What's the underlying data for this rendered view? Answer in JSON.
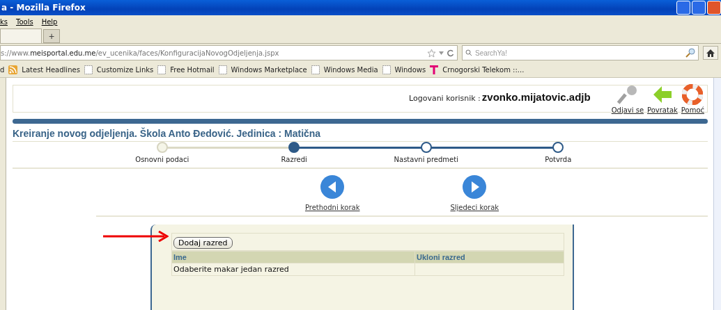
{
  "window": {
    "title": "a - Mozilla Firefox"
  },
  "menu": [
    "ks",
    "Tools",
    "Help"
  ],
  "tabs": {
    "new_tab": "+"
  },
  "address_bar": {
    "url": "s://www.**meisportal.edu.me**/ev_ucenika/faces/KonfiguracijaNovogOdjeljenja.jspx"
  },
  "search": {
    "placeholder": "SearchYa!"
  },
  "bookmarks": [
    {
      "kind": "text",
      "label": "d"
    },
    {
      "kind": "feed",
      "label": "Latest Headlines"
    },
    {
      "kind": "page",
      "label": "Customize Links"
    },
    {
      "kind": "page",
      "label": "Free Hotmail"
    },
    {
      "kind": "page",
      "label": "Windows Marketplace"
    },
    {
      "kind": "page",
      "label": "Windows Media"
    },
    {
      "kind": "page",
      "label": "Windows"
    },
    {
      "kind": "telekom",
      "label": "Crnogorski Telekom ::..."
    }
  ],
  "header": {
    "user_label": "Logovani korisnik :",
    "username": "zvonko.mijatovic.adjb",
    "links": [
      {
        "kind": "logout",
        "label": "Odjavi se"
      },
      {
        "kind": "back",
        "label": "Povratak"
      },
      {
        "kind": "help",
        "label": "Pomoć"
      }
    ]
  },
  "page_title": "Kreiranje novog odjeljenja. Škola Anto Đedović. Jedinica : Matična",
  "steps": [
    {
      "label": "Osnovni podaci",
      "visited": true,
      "selected": false
    },
    {
      "label": "Razredi",
      "visited": true,
      "selected": true
    },
    {
      "label": "Nastavni predmeti",
      "visited": false,
      "selected": false
    },
    {
      "label": "Potvrda",
      "visited": false,
      "selected": false
    }
  ],
  "navigation": [
    {
      "kind": "prev",
      "label": "Prethodni korak"
    },
    {
      "kind": "next",
      "label": "Sljedeci korak"
    }
  ],
  "panel": {
    "add_button": "Dodaj razred",
    "columns": [
      "Ime",
      "Ukloni razred"
    ],
    "rows": [
      {
        "ime": "Odaberite makar jedan razred"
      }
    ]
  }
}
